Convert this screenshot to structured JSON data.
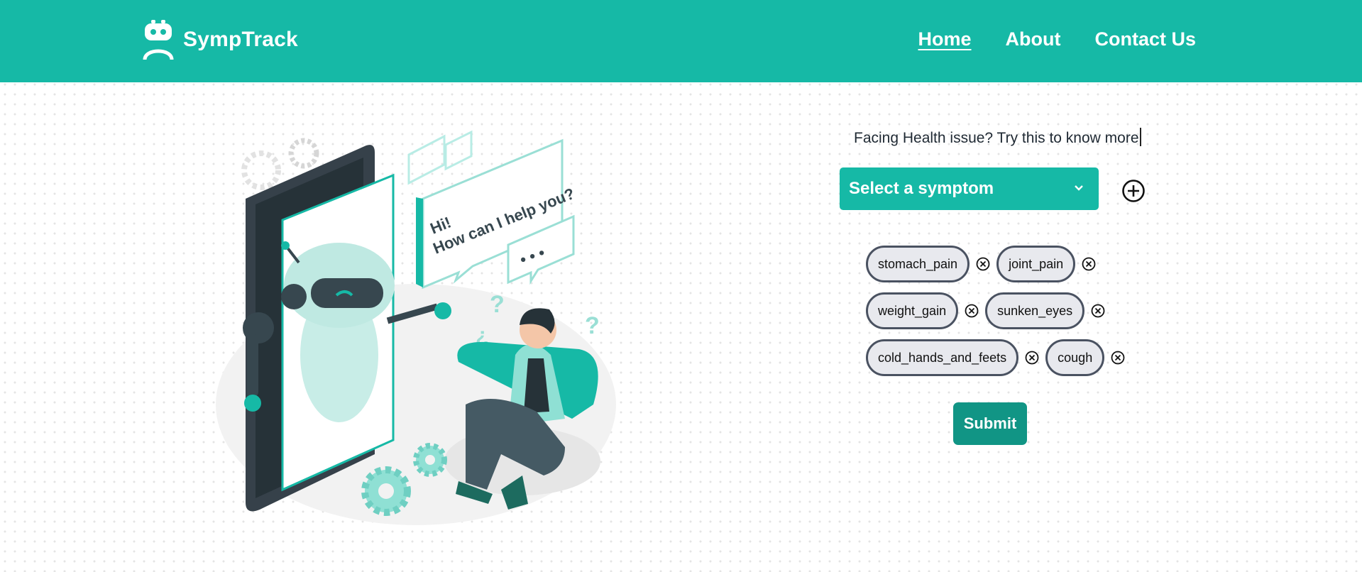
{
  "brand": {
    "name": "SympTrack",
    "icon": "robot-icon"
  },
  "nav": {
    "links": [
      {
        "label": "Home",
        "active": true
      },
      {
        "label": "About"
      },
      {
        "label": "Contact Us"
      }
    ]
  },
  "illustration": {
    "bubble_line1": "Hi!",
    "bubble_line2": "How can I help you?",
    "dots": "• • •"
  },
  "form": {
    "prompt": "Facing Health issue? Try this to know more",
    "select_label": "Select a symptom",
    "add_icon": "plus-circle-icon",
    "submit_label": "Submit"
  },
  "symptoms": [
    [
      "stomach_pain",
      "joint_pain"
    ],
    [
      "weight_gain",
      "sunken_eyes"
    ],
    [
      "cold_hands_and_feets",
      "cough"
    ]
  ],
  "colors": {
    "primary": "#16b9a6",
    "submit": "#119585",
    "chip_bg": "#e8e9ee",
    "chip_border": "#4a5261"
  }
}
